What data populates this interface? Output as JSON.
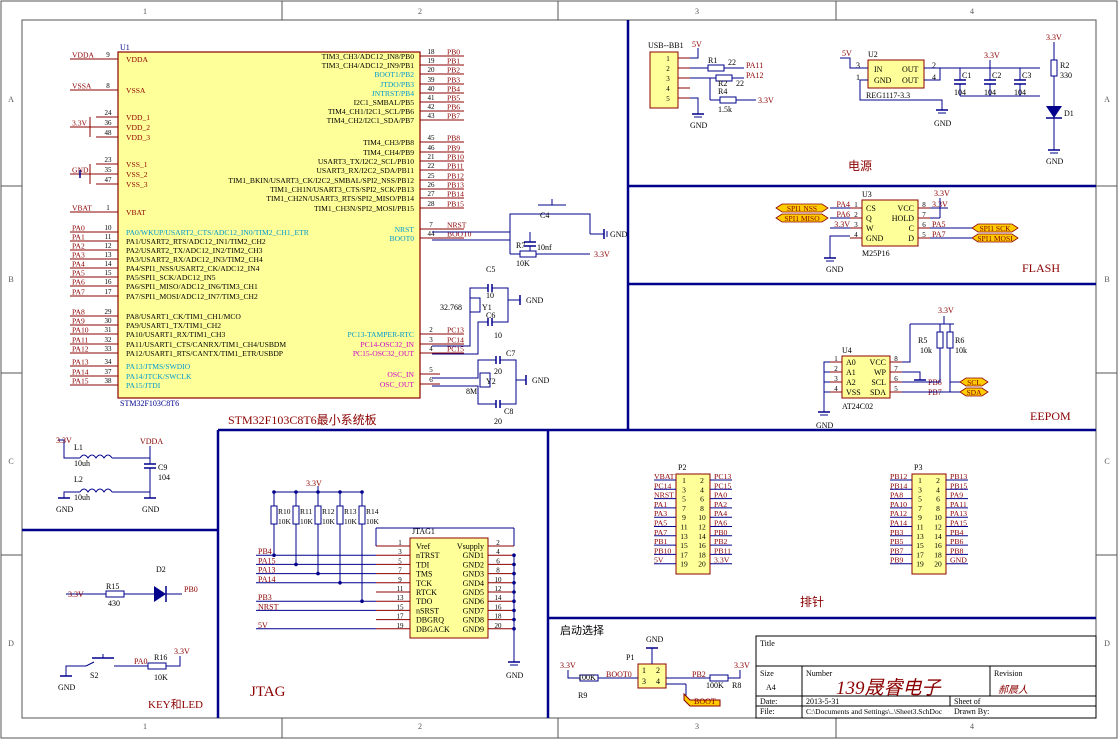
{
  "grid": {
    "columns": [
      "1",
      "2",
      "3",
      "4"
    ],
    "rows": [
      "A",
      "B",
      "C",
      "D"
    ]
  },
  "sections": {
    "mcu": "STM32F103C8T6最小系统板",
    "power": "电源",
    "flash": "FLASH",
    "eeprom": "EEPOM",
    "header": "排针",
    "jtag": "JTAG",
    "keyled": "KEY和LED",
    "boot": "启动选择"
  },
  "u1": {
    "ref": "U1",
    "part": "STM32F103C8T6",
    "left_pins": [
      {
        "num": "9",
        "name": "VDDA",
        "net": "VDDA",
        "cls": "pwr"
      },
      {
        "num": "8",
        "name": "VSSA",
        "net": "VSSA",
        "cls": "pwr"
      },
      {
        "num": "24",
        "name": "VDD_1",
        "net": "",
        "cls": "pwr"
      },
      {
        "num": "36",
        "name": "VDD_2",
        "net": "3.3V",
        "cls": "pwr"
      },
      {
        "num": "48",
        "name": "VDD_3",
        "net": "",
        "cls": "pwr"
      },
      {
        "num": "23",
        "name": "VSS_1",
        "net": "",
        "cls": "pwr"
      },
      {
        "num": "35",
        "name": "VSS_2",
        "net": "GND",
        "cls": "pwr"
      },
      {
        "num": "47",
        "name": "VSS_3",
        "net": "",
        "cls": "pwr"
      },
      {
        "num": "1",
        "name": "VBAT",
        "net": "VBAT",
        "cls": "pwr"
      },
      {
        "num": "10",
        "name": "PA0/WKUP/USART2_CTS/ADC12_IN0/TIM2_CH1_ETR",
        "net": "PA0",
        "cls": "alt"
      },
      {
        "num": "11",
        "name": "PA1/USART2_RTS/ADC12_IN1/TIM2_CH2",
        "net": "PA1",
        "cls": "io"
      },
      {
        "num": "12",
        "name": "PA2/USART2_TX/ADC12_IN2/TIM2_CH3",
        "net": "PA2",
        "cls": "io"
      },
      {
        "num": "13",
        "name": "PA3/USART2_RX/ADC12_IN3/TIM2_CH4",
        "net": "PA3",
        "cls": "io"
      },
      {
        "num": "14",
        "name": "PA4/SPI1_NSS/USART2_CK/ADC12_IN4",
        "net": "PA4",
        "cls": "io"
      },
      {
        "num": "15",
        "name": "PA5/SPI1_SCK/ADC12_IN5",
        "net": "PA5",
        "cls": "io"
      },
      {
        "num": "16",
        "name": "PA6/SPI1_MISO/ADC12_IN6/TIM3_CH1",
        "net": "PA6",
        "cls": "io"
      },
      {
        "num": "17",
        "name": "PA7/SPI1_MOSI/ADC12_IN7/TIM3_CH2",
        "net": "PA7",
        "cls": "io"
      },
      {
        "num": "29",
        "name": "PA8/USART1_CK/TIM1_CH1/MCO",
        "net": "PA8",
        "cls": "io"
      },
      {
        "num": "30",
        "name": "PA9/USART1_TX/TIM1_CH2",
        "net": "PA9",
        "cls": "io"
      },
      {
        "num": "31",
        "name": "PA10/USART1_RX/TIM1_CH3",
        "net": "PA10",
        "cls": "io"
      },
      {
        "num": "32",
        "name": "PA11/USART1_CTS/CANRX/TIM1_CH4/USBDM",
        "net": "PA11",
        "cls": "io"
      },
      {
        "num": "33",
        "name": "PA12/USART1_RTS/CANTX/TIM1_ETR/USBDP",
        "net": "PA12",
        "cls": "io"
      },
      {
        "num": "34",
        "name": "PA13/JTMS/SWDIO",
        "net": "PA13",
        "cls": "alt"
      },
      {
        "num": "37",
        "name": "PA14/JTCK/SWCLK",
        "net": "PA14",
        "cls": "alt"
      },
      {
        "num": "38",
        "name": "PA15/JTDI",
        "net": "PA15",
        "cls": "alt"
      }
    ],
    "right_pins": [
      {
        "num": "18",
        "name": "TIM3_CH3/ADC12_IN8/PB0",
        "net": "PB0",
        "cls": "io"
      },
      {
        "num": "19",
        "name": "TIM3_CH4/ADC12_IN9/PB1",
        "net": "PB1",
        "cls": "io"
      },
      {
        "num": "20",
        "name": "BOOT1/PB2",
        "net": "PB2",
        "cls": "alt"
      },
      {
        "num": "39",
        "name": "JTDO/PB3",
        "net": "PB3",
        "cls": "alt"
      },
      {
        "num": "40",
        "name": "JNTRST/PB4",
        "net": "PB4",
        "cls": "alt"
      },
      {
        "num": "41",
        "name": "I2C1_SMBAL/PB5",
        "net": "PB5",
        "cls": "io"
      },
      {
        "num": "42",
        "name": "TIM4_CH1/I2C1_SCL/PB6",
        "net": "PB6",
        "cls": "io"
      },
      {
        "num": "43",
        "name": "TIM4_CH2/I2C1_SDA/PB7",
        "net": "PB7",
        "cls": "io"
      },
      {
        "num": "45",
        "name": "TIM4_CH3/PB8",
        "net": "PB8",
        "cls": "io"
      },
      {
        "num": "46",
        "name": "TIM4_CH4/PB9",
        "net": "PB9",
        "cls": "io"
      },
      {
        "num": "21",
        "name": "USART3_TX/I2C2_SCL/PB10",
        "net": "PB10",
        "cls": "io"
      },
      {
        "num": "22",
        "name": "USART3_RX/I2C2_SDA/PB11",
        "net": "PB11",
        "cls": "io"
      },
      {
        "num": "25",
        "name": "TIM1_BKIN/USART3_CK/I2C2_SMBAL/SPI2_NSS/PB12",
        "net": "PB12",
        "cls": "io"
      },
      {
        "num": "26",
        "name": "TIM1_CH1N/USART3_CTS/SPI2_SCK/PB13",
        "net": "PB13",
        "cls": "io"
      },
      {
        "num": "27",
        "name": "TIM1_CH2N/USART3_RTS/SPI2_MISO/PB14",
        "net": "PB14",
        "cls": "io"
      },
      {
        "num": "28",
        "name": "TIM1_CH3N/SPI2_MOSI/PB15",
        "net": "PB15",
        "cls": "io"
      },
      {
        "num": "7",
        "name": "NRST",
        "net": "NRST",
        "cls": "alt"
      },
      {
        "num": "44",
        "name": "BOOT0",
        "net": "BOOT0",
        "cls": "alt"
      },
      {
        "num": "2",
        "name": "PC13-TAMPER-RTC",
        "net": "PC13",
        "cls": "alt"
      },
      {
        "num": "3",
        "name": "PC14-OSC32_IN",
        "net": "PC14",
        "cls": "osc"
      },
      {
        "num": "4",
        "name": "PC15-OSC32_OUT",
        "net": "PC15",
        "cls": "osc"
      },
      {
        "num": "5",
        "name": "OSC_IN",
        "net": "",
        "cls": "osc"
      },
      {
        "num": "6",
        "name": "OSC_OUT",
        "net": "",
        "cls": "osc"
      }
    ]
  },
  "reset": {
    "cap": "C4",
    "cap_val": "10nf",
    "res": "R7",
    "res_val": "10K",
    "gnd": "GND",
    "vcc": "3.3V"
  },
  "rtc": {
    "xtal": "Y1",
    "freq": "32.768",
    "c1": "C5",
    "c1v": "10",
    "c2": "C6",
    "c2v": "10",
    "gnd": "GND"
  },
  "hse": {
    "xtal": "Y2",
    "freq": "8M",
    "c1": "C7",
    "c1v": "20",
    "c2": "C8",
    "c2v": "20",
    "gnd": "GND"
  },
  "usb": {
    "ref": "USB--BB1",
    "pins": [
      "1",
      "2",
      "3",
      "4",
      "5"
    ],
    "vcc": "5V",
    "r1": "R1",
    "r1v": "22",
    "r2": "R2",
    "r2v": "22",
    "r4": "R4",
    "r4v": "1.5k",
    "net1": "PA11",
    "net2": "PA12",
    "pull": "3.3V",
    "gnd": "GND"
  },
  "reg": {
    "ref": "U2",
    "part": "REG1117-3.3",
    "in": "IN",
    "out": "OUT",
    "gnd": "GND",
    "out2": "OUT",
    "p3": "3",
    "p1": "1",
    "p2": "2",
    "p4": "4",
    "vin": "5V",
    "vout": "3.3V",
    "c1": "C1",
    "c1v": "104",
    "c2": "C2",
    "c2v": "104",
    "c3": "C3",
    "c3v": "104",
    "gndl": "GND"
  },
  "pled": {
    "r": "R2",
    "rv": "330",
    "d": "D1",
    "vcc": "3.3V",
    "gnd": "GND"
  },
  "flash": {
    "ref": "U3",
    "part": "M25P16",
    "left": [
      {
        "num": "1",
        "name": "CS",
        "net": "PA4"
      },
      {
        "num": "2",
        "name": "Q",
        "net": "PA6"
      },
      {
        "num": "3",
        "name": "W",
        "net": "3.3V"
      },
      {
        "num": "4",
        "name": "GND",
        "net": ""
      }
    ],
    "right": [
      {
        "num": "8",
        "name": "VCC",
        "net": "3.3V"
      },
      {
        "num": "7",
        "name": "HOLD",
        "net": ""
      },
      {
        "num": "6",
        "name": "C",
        "net": "PA5"
      },
      {
        "num": "5",
        "name": "D",
        "net": "PA7"
      }
    ],
    "tags_left": [
      "SPI1 NSS",
      "SPI1 MISO"
    ],
    "tags_right": [
      "SPI1 SCK",
      "SPI1 MOSI"
    ],
    "gnd": "GND"
  },
  "eeprom": {
    "ref": "U4",
    "part": "AT24C02",
    "left": [
      {
        "num": "1",
        "name": "A0"
      },
      {
        "num": "2",
        "name": "A1"
      },
      {
        "num": "3",
        "name": "A2"
      },
      {
        "num": "4",
        "name": "VSS"
      }
    ],
    "right": [
      {
        "num": "8",
        "name": "VCC"
      },
      {
        "num": "7",
        "name": "WP"
      },
      {
        "num": "6",
        "name": "SCL",
        "net": "PB6"
      },
      {
        "num": "5",
        "name": "SDA",
        "net": "PB7"
      }
    ],
    "r5": "R5",
    "r5v": "10k",
    "r6": "R6",
    "r6v": "10k",
    "vcc": "3.3V",
    "gnd": "GND",
    "tags": [
      "SCL",
      "SDA"
    ]
  },
  "filter": {
    "l1": "L1",
    "l1v": "10uh",
    "l2": "L2",
    "l2v": "10uh",
    "c": "C9",
    "cv": "104",
    "vin": "3.3V",
    "vout": "VDDA",
    "gnd1": "GND",
    "gnd2": "GND"
  },
  "p2": {
    "ref": "P2",
    "left_nets": [
      "VBAT",
      "PC14",
      "NRST",
      "PA1",
      "PA3",
      "PA5",
      "PA7",
      "PB1",
      "PB10",
      "5V"
    ],
    "left_nums": [
      "1",
      "3",
      "5",
      "7",
      "9",
      "11",
      "13",
      "15",
      "17",
      "19"
    ],
    "right_nums": [
      "2",
      "4",
      "6",
      "8",
      "10",
      "12",
      "14",
      "16",
      "18",
      "20"
    ],
    "right_nets": [
      "PC13",
      "PC15",
      "PA0",
      "PA2",
      "PA4",
      "PA6",
      "PB0",
      "PB2",
      "PB11",
      "3.3V"
    ]
  },
  "p3": {
    "ref": "P3",
    "left_nets": [
      "PB12",
      "PB14",
      "PA8",
      "PA10",
      "PA12",
      "PA14",
      "PB3",
      "PB5",
      "PB7",
      "PB9"
    ],
    "left_nums": [
      "1",
      "3",
      "5",
      "7",
      "9",
      "11",
      "13",
      "15",
      "17",
      "19"
    ],
    "right_nums": [
      "2",
      "4",
      "6",
      "8",
      "10",
      "12",
      "14",
      "16",
      "18",
      "20"
    ],
    "right_nets": [
      "PB13",
      "PB15",
      "PA9",
      "PA11",
      "PA13",
      "PA15",
      "PB4",
      "PB6",
      "PB8",
      "GND"
    ]
  },
  "jtag": {
    "ref": "JTAG1",
    "vcc": "3.3V",
    "resistors": [
      {
        "r": "R10",
        "v": "10K"
      },
      {
        "r": "R11",
        "v": "10K"
      },
      {
        "r": "R12",
        "v": "10K"
      },
      {
        "r": "R13",
        "v": "10K"
      },
      {
        "r": "R14",
        "v": "10K"
      }
    ],
    "left": [
      {
        "num": "1",
        "name": "Vref",
        "net": ""
      },
      {
        "num": "3",
        "name": "nTRST",
        "net": "PB4"
      },
      {
        "num": "5",
        "name": "TDI",
        "net": "PA15"
      },
      {
        "num": "7",
        "name": "TMS",
        "net": "PA13"
      },
      {
        "num": "9",
        "name": "TCK",
        "net": "PA14"
      },
      {
        "num": "11",
        "name": "RTCK",
        "net": ""
      },
      {
        "num": "13",
        "name": "TDO",
        "net": "PB3"
      },
      {
        "num": "15",
        "name": "nSRST",
        "net": "NRST"
      },
      {
        "num": "17",
        "name": "DBGRQ",
        "net": ""
      },
      {
        "num": "19",
        "name": "DBGACK",
        "net": "5V"
      }
    ],
    "right": [
      {
        "num": "2",
        "name": "Vsupply"
      },
      {
        "num": "4",
        "name": "GND1"
      },
      {
        "num": "6",
        "name": "GND2"
      },
      {
        "num": "8",
        "name": "GND3"
      },
      {
        "num": "10",
        "name": "GND4"
      },
      {
        "num": "12",
        "name": "GND5"
      },
      {
        "num": "14",
        "name": "GND6"
      },
      {
        "num": "16",
        "name": "GND7"
      },
      {
        "num": "18",
        "name": "GND8"
      },
      {
        "num": "20",
        "name": "GND9"
      }
    ],
    "gnd": "GND"
  },
  "keyled": {
    "r15": "R15",
    "r15v": "430",
    "d2": "D2",
    "led_net": "PB0",
    "vcc": "3.3V",
    "r16": "R16",
    "r16v": "10K",
    "s2": "S2",
    "key_net": "PA0",
    "vcc2": "3.3V",
    "gnd": "GND"
  },
  "bootsel": {
    "p1": "P1",
    "pins": [
      "1",
      "2",
      "3",
      "4"
    ],
    "gnd": "GND",
    "vl": "3.3V",
    "r9": "R9",
    "r9v": "100K",
    "boot0": "BOOT0",
    "pb2": "PB2",
    "r8": "R8",
    "r8v": "100K",
    "vr": "3.3V",
    "tag": "BOOT"
  },
  "title": {
    "title_lbl": "Title",
    "size_lbl": "Size",
    "size": "A4",
    "number_lbl": "Number",
    "number": "139晟睿电子",
    "revision_lbl": "Revision",
    "date_lbl": "Date:",
    "date": "2013-5-31",
    "sheet_lbl": "Sheet   of",
    "file_lbl": "File:",
    "file": "C:\\Documents and Settings\\..\\Sheet3.SchDoc",
    "drawn_lbl": "Drawn By:",
    "signature": "郝晨人"
  },
  "colors": {
    "wire": "#00008b",
    "comp": "#8b0000",
    "ic_fill": "#ffff99",
    "pin_blue": "#0099cc",
    "pin_magenta": "#cc00cc",
    "tag_fill": "#ffcc00",
    "border": "#000080",
    "text": "#000000",
    "frame": "#555555"
  }
}
